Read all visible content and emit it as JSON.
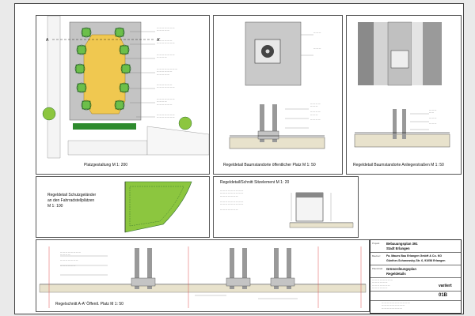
{
  "panels": {
    "plaza": {
      "caption": "Platzgestaltung M 1: 200",
      "street_label": "Straße",
      "plaza_label": "Öffentlicher Platz"
    },
    "tree_public": {
      "caption": "Regeldetail Baumstandorte öffentlicher Platz M 1: 50"
    },
    "tree_street": {
      "caption": "Regeldetail Baumstandorte Anliegerstraßen M 1: 50"
    },
    "railing": {
      "caption_line1": "Regeldetail Schutzgeländer",
      "caption_line2": "an den Fahrradstellplätzen",
      "caption_line3": "M 1: 100"
    },
    "seat": {
      "caption": "Regeldetail/Schnitt Sitzelement M 1: 20"
    },
    "section": {
      "caption": "Regelschnitt A-A' Öffentl. Platz M 1: 50"
    }
  },
  "title_block": {
    "project_label": "Projekt",
    "project_line1": "Bebauungsplan 391",
    "project_line2": "Stadt Erlangen",
    "client_label": "Bauherr",
    "client_line1": "Fa. Maues Bau Erlangen GmbH & Co. KG",
    "client_line2": "Günther-Scharowsky-Str. 6, 91058 Erlangen",
    "content_label": "Planinhalt",
    "content_line1": "Grünordnungsplan",
    "content_line2": "Regeldetails",
    "status": "variiert",
    "plan_number": "01B"
  },
  "colors": {
    "green": "#8cc63f",
    "dark_green": "#2e8b2e",
    "sand": "#f0c850",
    "paving": "#b8b8b8"
  }
}
